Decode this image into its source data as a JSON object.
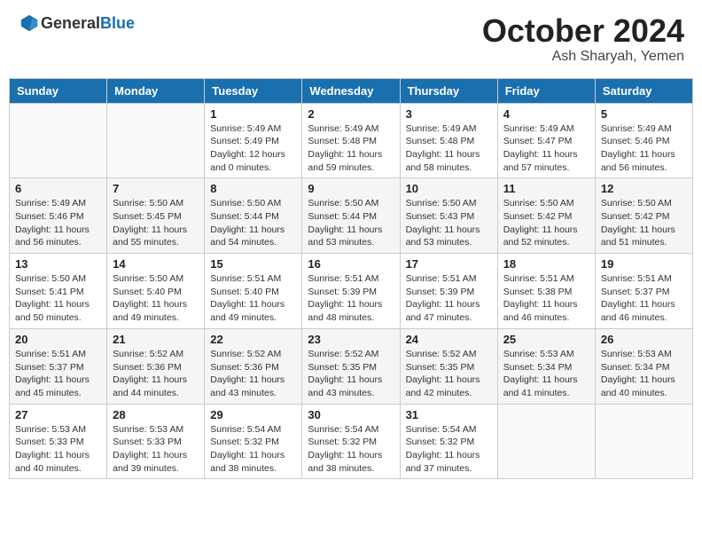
{
  "header": {
    "logo_general": "General",
    "logo_blue": "Blue",
    "month": "October 2024",
    "location": "Ash Sharyah, Yemen"
  },
  "weekdays": [
    "Sunday",
    "Monday",
    "Tuesday",
    "Wednesday",
    "Thursday",
    "Friday",
    "Saturday"
  ],
  "weeks": [
    [
      {
        "day": "",
        "sunrise": "",
        "sunset": "",
        "daylight": ""
      },
      {
        "day": "",
        "sunrise": "",
        "sunset": "",
        "daylight": ""
      },
      {
        "day": "1",
        "sunrise": "Sunrise: 5:49 AM",
        "sunset": "Sunset: 5:49 PM",
        "daylight": "Daylight: 12 hours and 0 minutes."
      },
      {
        "day": "2",
        "sunrise": "Sunrise: 5:49 AM",
        "sunset": "Sunset: 5:48 PM",
        "daylight": "Daylight: 11 hours and 59 minutes."
      },
      {
        "day": "3",
        "sunrise": "Sunrise: 5:49 AM",
        "sunset": "Sunset: 5:48 PM",
        "daylight": "Daylight: 11 hours and 58 minutes."
      },
      {
        "day": "4",
        "sunrise": "Sunrise: 5:49 AM",
        "sunset": "Sunset: 5:47 PM",
        "daylight": "Daylight: 11 hours and 57 minutes."
      },
      {
        "day": "5",
        "sunrise": "Sunrise: 5:49 AM",
        "sunset": "Sunset: 5:46 PM",
        "daylight": "Daylight: 11 hours and 56 minutes."
      }
    ],
    [
      {
        "day": "6",
        "sunrise": "Sunrise: 5:49 AM",
        "sunset": "Sunset: 5:46 PM",
        "daylight": "Daylight: 11 hours and 56 minutes."
      },
      {
        "day": "7",
        "sunrise": "Sunrise: 5:50 AM",
        "sunset": "Sunset: 5:45 PM",
        "daylight": "Daylight: 11 hours and 55 minutes."
      },
      {
        "day": "8",
        "sunrise": "Sunrise: 5:50 AM",
        "sunset": "Sunset: 5:44 PM",
        "daylight": "Daylight: 11 hours and 54 minutes."
      },
      {
        "day": "9",
        "sunrise": "Sunrise: 5:50 AM",
        "sunset": "Sunset: 5:44 PM",
        "daylight": "Daylight: 11 hours and 53 minutes."
      },
      {
        "day": "10",
        "sunrise": "Sunrise: 5:50 AM",
        "sunset": "Sunset: 5:43 PM",
        "daylight": "Daylight: 11 hours and 53 minutes."
      },
      {
        "day": "11",
        "sunrise": "Sunrise: 5:50 AM",
        "sunset": "Sunset: 5:42 PM",
        "daylight": "Daylight: 11 hours and 52 minutes."
      },
      {
        "day": "12",
        "sunrise": "Sunrise: 5:50 AM",
        "sunset": "Sunset: 5:42 PM",
        "daylight": "Daylight: 11 hours and 51 minutes."
      }
    ],
    [
      {
        "day": "13",
        "sunrise": "Sunrise: 5:50 AM",
        "sunset": "Sunset: 5:41 PM",
        "daylight": "Daylight: 11 hours and 50 minutes."
      },
      {
        "day": "14",
        "sunrise": "Sunrise: 5:50 AM",
        "sunset": "Sunset: 5:40 PM",
        "daylight": "Daylight: 11 hours and 49 minutes."
      },
      {
        "day": "15",
        "sunrise": "Sunrise: 5:51 AM",
        "sunset": "Sunset: 5:40 PM",
        "daylight": "Daylight: 11 hours and 49 minutes."
      },
      {
        "day": "16",
        "sunrise": "Sunrise: 5:51 AM",
        "sunset": "Sunset: 5:39 PM",
        "daylight": "Daylight: 11 hours and 48 minutes."
      },
      {
        "day": "17",
        "sunrise": "Sunrise: 5:51 AM",
        "sunset": "Sunset: 5:39 PM",
        "daylight": "Daylight: 11 hours and 47 minutes."
      },
      {
        "day": "18",
        "sunrise": "Sunrise: 5:51 AM",
        "sunset": "Sunset: 5:38 PM",
        "daylight": "Daylight: 11 hours and 46 minutes."
      },
      {
        "day": "19",
        "sunrise": "Sunrise: 5:51 AM",
        "sunset": "Sunset: 5:37 PM",
        "daylight": "Daylight: 11 hours and 46 minutes."
      }
    ],
    [
      {
        "day": "20",
        "sunrise": "Sunrise: 5:51 AM",
        "sunset": "Sunset: 5:37 PM",
        "daylight": "Daylight: 11 hours and 45 minutes."
      },
      {
        "day": "21",
        "sunrise": "Sunrise: 5:52 AM",
        "sunset": "Sunset: 5:36 PM",
        "daylight": "Daylight: 11 hours and 44 minutes."
      },
      {
        "day": "22",
        "sunrise": "Sunrise: 5:52 AM",
        "sunset": "Sunset: 5:36 PM",
        "daylight": "Daylight: 11 hours and 43 minutes."
      },
      {
        "day": "23",
        "sunrise": "Sunrise: 5:52 AM",
        "sunset": "Sunset: 5:35 PM",
        "daylight": "Daylight: 11 hours and 43 minutes."
      },
      {
        "day": "24",
        "sunrise": "Sunrise: 5:52 AM",
        "sunset": "Sunset: 5:35 PM",
        "daylight": "Daylight: 11 hours and 42 minutes."
      },
      {
        "day": "25",
        "sunrise": "Sunrise: 5:53 AM",
        "sunset": "Sunset: 5:34 PM",
        "daylight": "Daylight: 11 hours and 41 minutes."
      },
      {
        "day": "26",
        "sunrise": "Sunrise: 5:53 AM",
        "sunset": "Sunset: 5:34 PM",
        "daylight": "Daylight: 11 hours and 40 minutes."
      }
    ],
    [
      {
        "day": "27",
        "sunrise": "Sunrise: 5:53 AM",
        "sunset": "Sunset: 5:33 PM",
        "daylight": "Daylight: 11 hours and 40 minutes."
      },
      {
        "day": "28",
        "sunrise": "Sunrise: 5:53 AM",
        "sunset": "Sunset: 5:33 PM",
        "daylight": "Daylight: 11 hours and 39 minutes."
      },
      {
        "day": "29",
        "sunrise": "Sunrise: 5:54 AM",
        "sunset": "Sunset: 5:32 PM",
        "daylight": "Daylight: 11 hours and 38 minutes."
      },
      {
        "day": "30",
        "sunrise": "Sunrise: 5:54 AM",
        "sunset": "Sunset: 5:32 PM",
        "daylight": "Daylight: 11 hours and 38 minutes."
      },
      {
        "day": "31",
        "sunrise": "Sunrise: 5:54 AM",
        "sunset": "Sunset: 5:32 PM",
        "daylight": "Daylight: 11 hours and 37 minutes."
      },
      {
        "day": "",
        "sunrise": "",
        "sunset": "",
        "daylight": ""
      },
      {
        "day": "",
        "sunrise": "",
        "sunset": "",
        "daylight": ""
      }
    ]
  ]
}
